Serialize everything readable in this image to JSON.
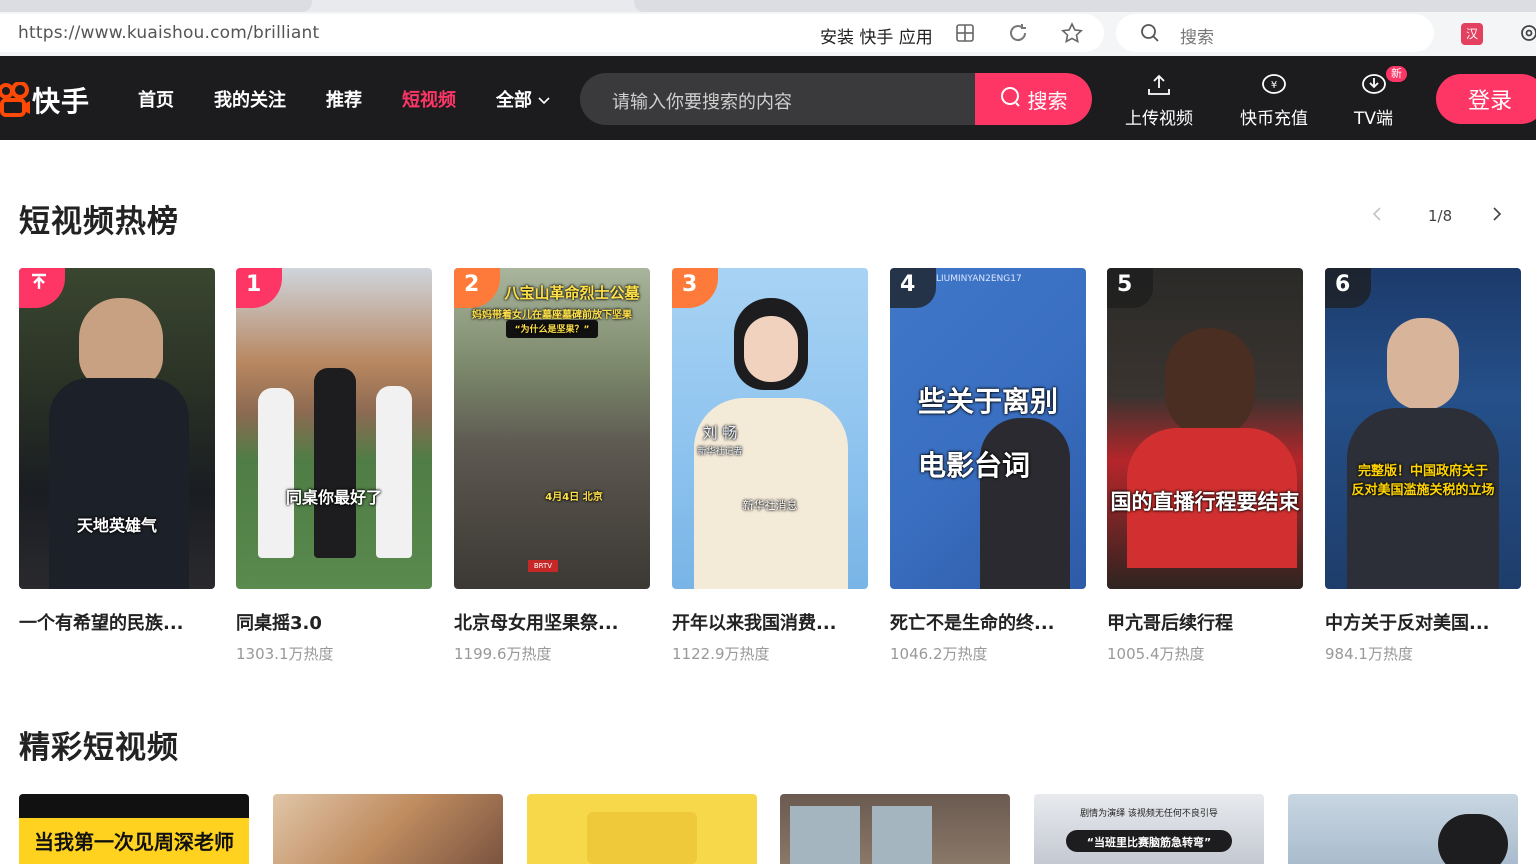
{
  "browser": {
    "url": "https://www.kuaishou.com/brilliant",
    "install_app": "安装 快手 应用",
    "search_placeholder": "搜索"
  },
  "header": {
    "logo_text": "快手",
    "nav": [
      {
        "label": "首页",
        "active": false
      },
      {
        "label": "我的关注",
        "active": false
      },
      {
        "label": "推荐",
        "active": false
      },
      {
        "label": "短视频",
        "active": true
      },
      {
        "label": "全部",
        "active": false
      }
    ],
    "search_placeholder": "请输入你要搜索的内容",
    "search_button": "搜索",
    "actions": [
      {
        "label": "上传视频",
        "icon": "upload-icon"
      },
      {
        "label": "快币充值",
        "icon": "coin-icon"
      },
      {
        "label": "TV端",
        "icon": "tv-download-icon",
        "badge": "新"
      }
    ],
    "login": "登录",
    "accent_color": "#fe3666"
  },
  "hot_list": {
    "title": "短视频热榜",
    "page": "1/8",
    "cards": [
      {
        "rank": "",
        "title": "一个有希望的民族...",
        "heat": "",
        "caption": "天地英雄气",
        "pinned": true
      },
      {
        "rank": "1",
        "title": "同桌摇3.0",
        "heat": "1303.1万热度",
        "caption": "同桌你最好了"
      },
      {
        "rank": "2",
        "title": "北京母女用坚果祭...",
        "heat": "1199.6万热度",
        "caption": "八宝山革命烈士公墓",
        "caption2": "妈妈带着女儿在墓座墓碑前放下坚果",
        "caption3": "“为什么是坚果？”",
        "caption4": "4月4日 北京"
      },
      {
        "rank": "3",
        "title": "开年以来我国消费...",
        "heat": "1122.9万热度",
        "caption": "刘 畅",
        "caption2": "新华社记者",
        "caption3": "新华社消息"
      },
      {
        "rank": "4",
        "title": "死亡不是生命的终...",
        "heat": "1046.2万热度",
        "caption": "些关于离别",
        "caption2": "电影台词",
        "caption3": "LIUMINYAN2ENG17"
      },
      {
        "rank": "5",
        "title": "甲亢哥后续行程",
        "heat": "1005.4万热度",
        "caption": "国的直播行程要结束"
      },
      {
        "rank": "6",
        "title": "中方关于反对美国...",
        "heat": "984.1万热度",
        "caption": "完整版！中国政府关于",
        "caption2": "反对美国滥施关税的立场"
      }
    ]
  },
  "featured": {
    "title": "精彩短视频",
    "items": [
      {
        "caption": "当我第一次见周深老师"
      },
      {
        "caption": ""
      },
      {
        "caption": ""
      },
      {
        "caption": ""
      },
      {
        "caption": "剧情为演绎 该视频无任何不良引导",
        "caption2": "“当班里比赛脑筋急转弯”"
      },
      {
        "caption": ""
      }
    ]
  }
}
